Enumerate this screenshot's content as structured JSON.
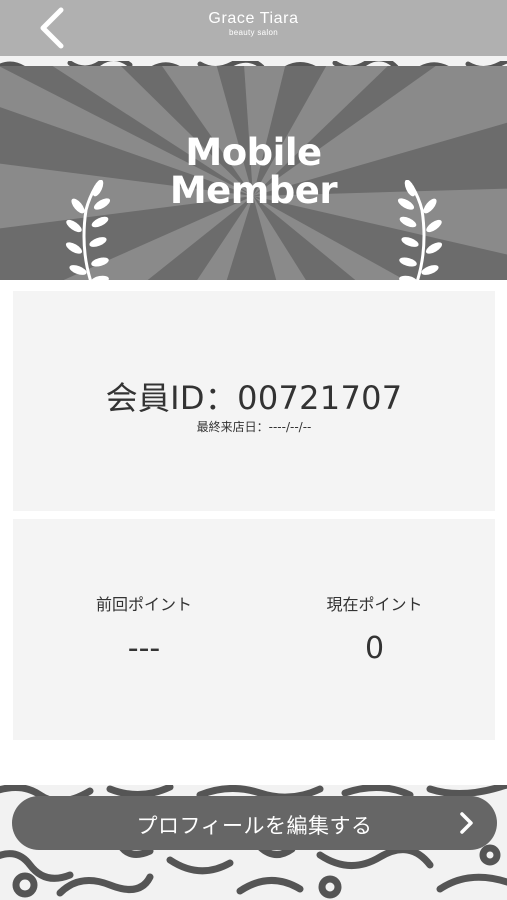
{
  "header": {
    "brand_name": "Grace Tiara",
    "brand_sub": "beauty salon",
    "back_icon": "chevron-left-icon"
  },
  "banner": {
    "title_line1": "Mobile",
    "title_line2": "Member",
    "left_icon": "laurel-branch-icon",
    "right_icon": "laurel-branch-icon"
  },
  "member": {
    "id_label": "会員ID：",
    "id_value": "00721707",
    "last_visit": "最終来店日：----/--/--"
  },
  "points": {
    "previous_label": "前回ポイント",
    "previous_value": "---",
    "current_label": "現在ポイント",
    "current_value": "0"
  },
  "profile_button": {
    "label": "プロフィールを編集する",
    "icon": "chevron-right-icon"
  },
  "colors": {
    "header_bg": "#b0b0b0",
    "banner_bg": "#6c6c6c",
    "card_bg": "#f4f4f4",
    "button_bg": "#666666",
    "pattern": "#555555"
  }
}
